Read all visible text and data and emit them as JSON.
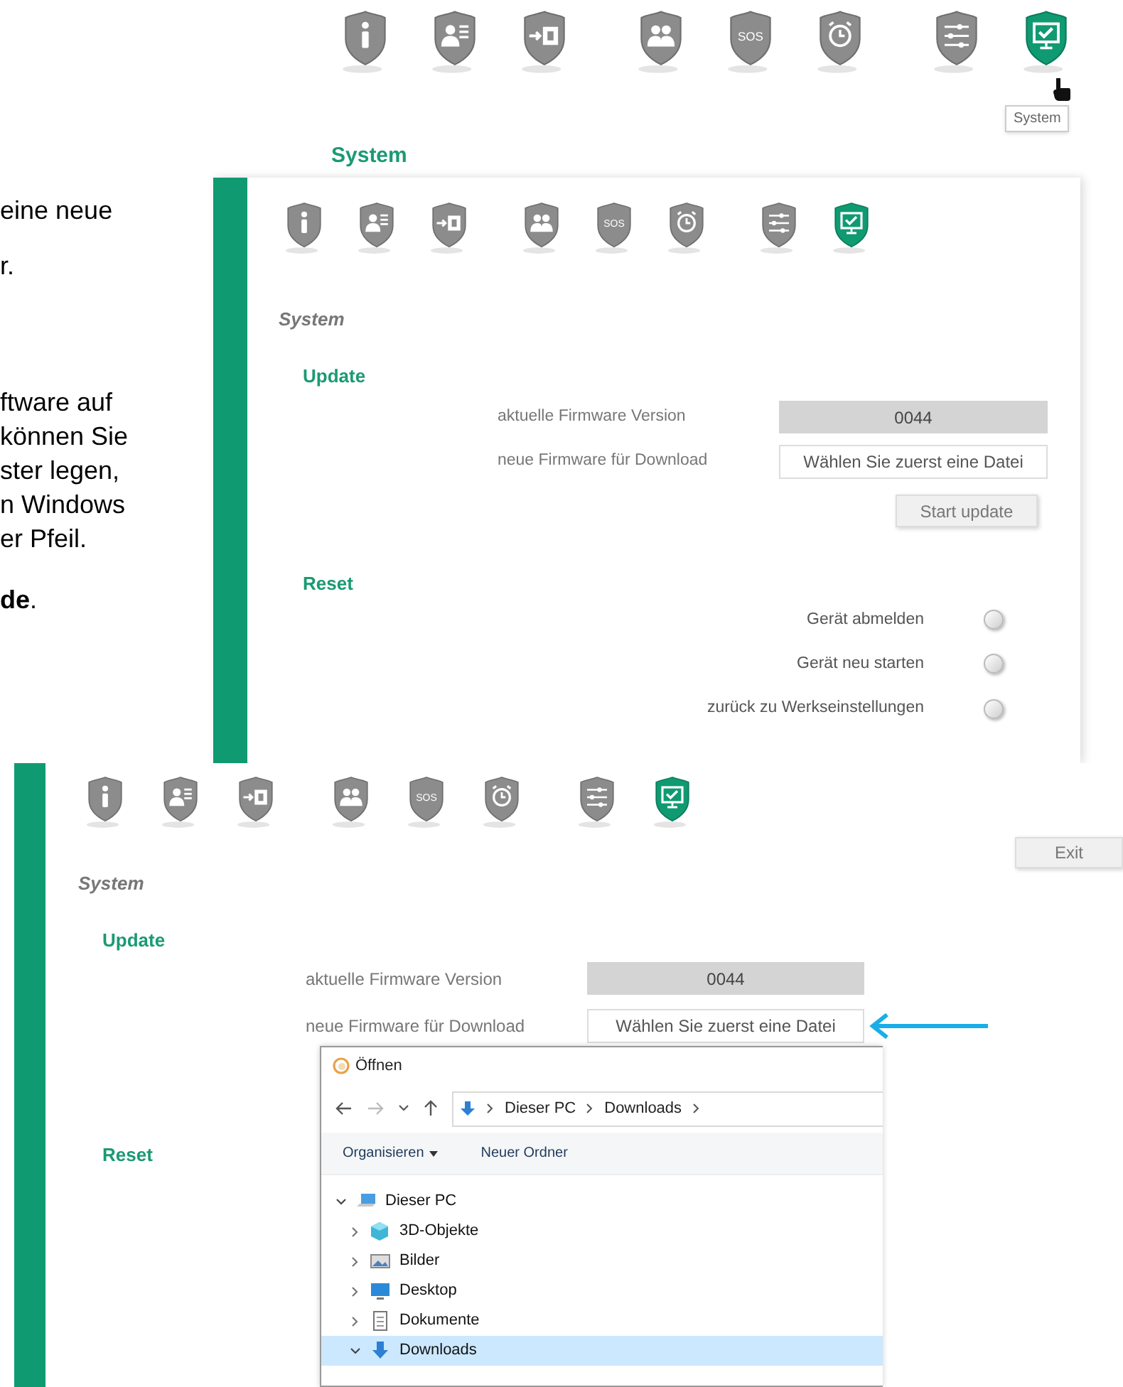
{
  "top_strip": {
    "icons": [
      {
        "selected": false
      },
      {
        "selected": false
      },
      {
        "selected": false
      },
      {
        "selected": false
      },
      {
        "selected": false,
        "label": "SOS"
      },
      {
        "selected": false
      },
      {
        "selected": false
      },
      {
        "selected": true
      }
    ],
    "tooltip": "System",
    "heading": "System"
  },
  "manual_text": [
    [
      "eine neue"
    ],
    [
      "r."
    ],
    [
      "ftware auf",
      "können Sie",
      "ster legen,",
      "n Windows",
      "er Pfeil."
    ],
    [
      "**de**."
    ]
  ],
  "screenshot_1": {
    "icons": [
      {
        "selected": false
      },
      {
        "selected": false
      },
      {
        "selected": false
      },
      {
        "selected": false
      },
      {
        "selected": false,
        "label": "SOS"
      },
      {
        "selected": false
      },
      {
        "selected": false
      },
      {
        "selected": true
      }
    ],
    "page_title": "System",
    "update": {
      "heading": "Update",
      "rows": [
        {
          "kind": "readonly",
          "label": "aktuelle Firmware Version",
          "value": "0044"
        },
        {
          "kind": "file",
          "label": "neue Firmware für Download",
          "value": "Wählen Sie zuerst eine Datei"
        }
      ],
      "button": "Start update"
    },
    "reset": {
      "heading": "Reset",
      "options": [
        {
          "label": "Gerät abmelden",
          "on": false
        },
        {
          "label": "Gerät neu starten",
          "on": false
        },
        {
          "label": "zurück zu Werkseinstellungen",
          "on": false
        }
      ]
    }
  },
  "screenshot_2": {
    "icons": [
      {
        "selected": false
      },
      {
        "selected": false
      },
      {
        "selected": false
      },
      {
        "selected": false
      },
      {
        "selected": false,
        "label": "SOS"
      },
      {
        "selected": false
      },
      {
        "selected": false
      },
      {
        "selected": true
      }
    ],
    "exit_button": "Exit",
    "page_title": "System",
    "update": {
      "heading": "Update",
      "rows": [
        {
          "kind": "readonly",
          "label": "aktuelle Firmware Version",
          "value": "0044"
        },
        {
          "kind": "file",
          "label": "neue Firmware für Download",
          "value": "Wählen Sie zuerst eine Datei"
        }
      ]
    },
    "reset": {
      "heading": "Reset"
    },
    "dialog": {
      "title": "Öffnen",
      "breadcrumb": [
        "Dieser PC",
        "Downloads"
      ],
      "toolbar": [
        "Organisieren",
        "Neuer Ordner"
      ],
      "tree": [
        {
          "label": "Dieser PC",
          "expanded": true,
          "selected": false,
          "children": [
            {
              "label": "3D-Objekte",
              "expanded": false,
              "selected": false
            },
            {
              "label": "Bilder",
              "expanded": false,
              "selected": false
            },
            {
              "label": "Desktop",
              "expanded": false,
              "selected": false
            },
            {
              "label": "Dokumente",
              "expanded": false,
              "selected": false
            },
            {
              "label": "Downloads",
              "expanded": true,
              "selected": true
            }
          ]
        }
      ]
    }
  }
}
